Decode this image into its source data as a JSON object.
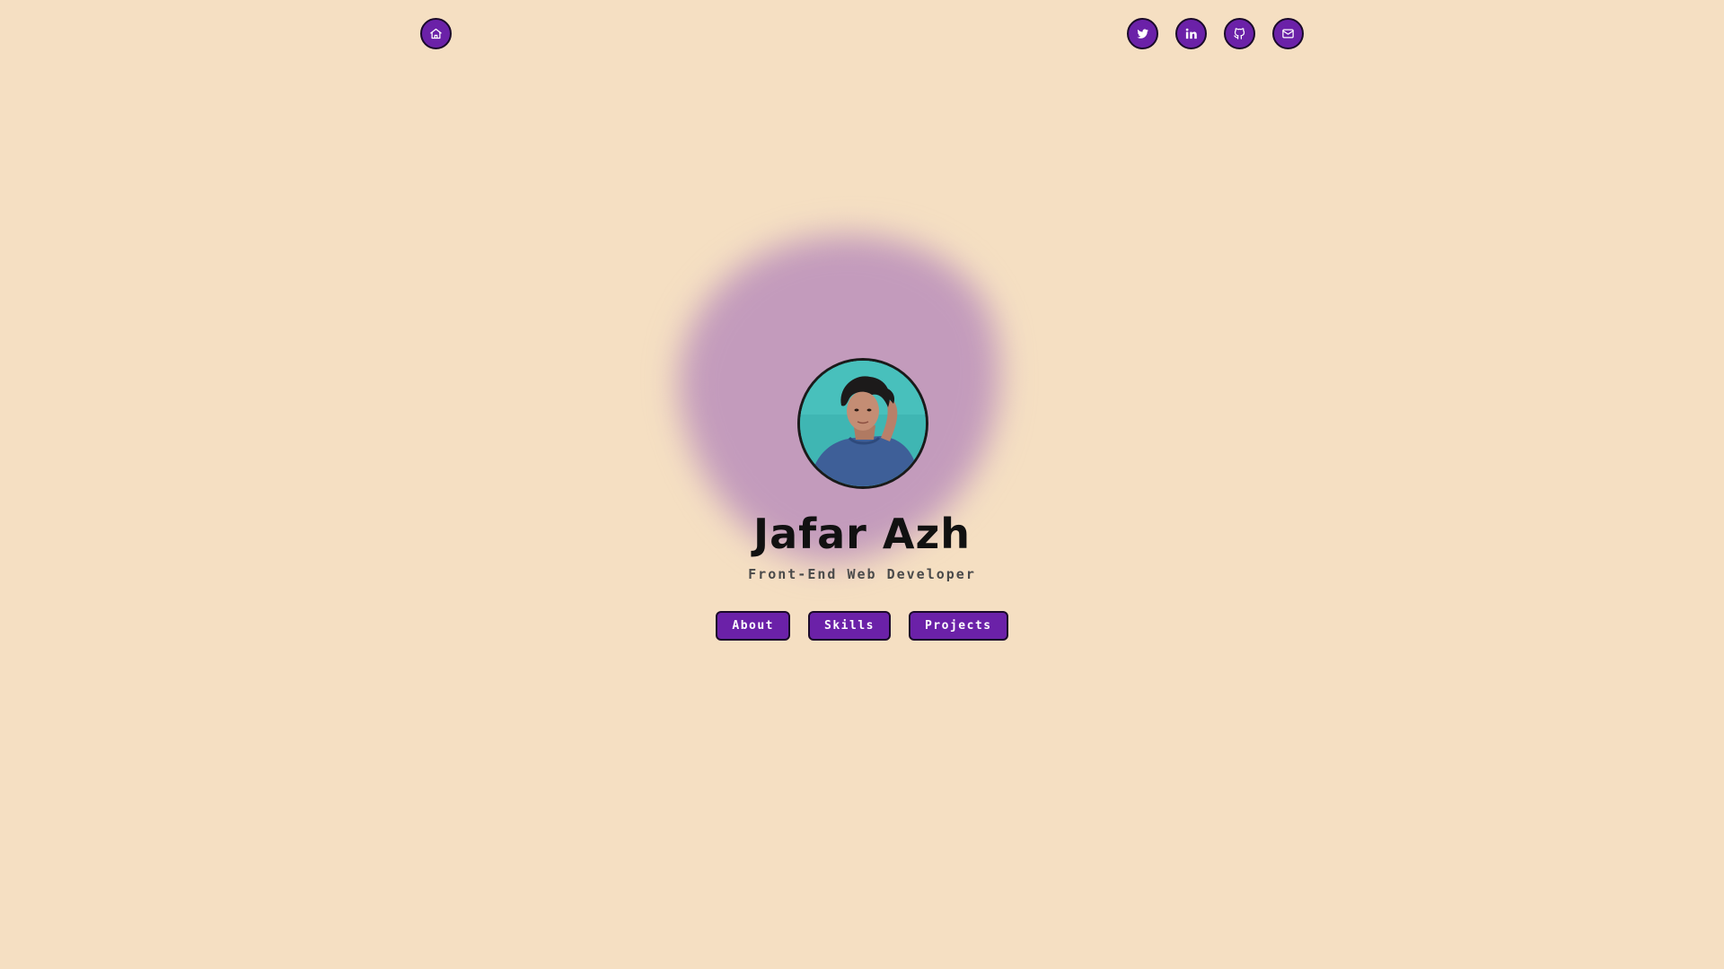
{
  "header": {
    "home_icon": "home-icon",
    "social": [
      {
        "name": "twitter",
        "icon": "twitter-icon"
      },
      {
        "name": "linkedin",
        "icon": "linkedin-icon"
      },
      {
        "name": "github",
        "icon": "github-icon"
      },
      {
        "name": "email",
        "icon": "mail-icon"
      }
    ]
  },
  "hero": {
    "name": "Jafar Azh",
    "role": "Front-End Web Developer"
  },
  "nav": {
    "about_label": "About",
    "skills_label": "Skills",
    "projects_label": "Projects"
  },
  "colors": {
    "background": "#f5dfc2",
    "accent": "#6b21a8",
    "blob": "#c39bbc",
    "text": "#111111"
  }
}
